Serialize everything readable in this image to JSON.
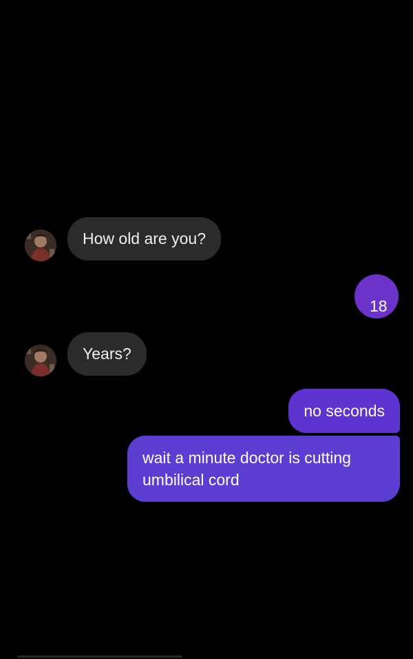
{
  "conversation": {
    "messages": [
      {
        "direction": "incoming",
        "text": "How old are you?"
      },
      {
        "direction": "outgoing",
        "text": "18"
      },
      {
        "direction": "incoming",
        "text": "Years?"
      },
      {
        "direction": "outgoing",
        "text": "no seconds"
      },
      {
        "direction": "outgoing",
        "text": "wait a minute doctor is cutting umbilical cord"
      }
    ]
  },
  "colors": {
    "background": "#000000",
    "incoming_bubble": "#2b2b2b",
    "outgoing_bubble": "#5d34cf"
  },
  "icons": {
    "avatar": "contact-avatar-icon"
  }
}
